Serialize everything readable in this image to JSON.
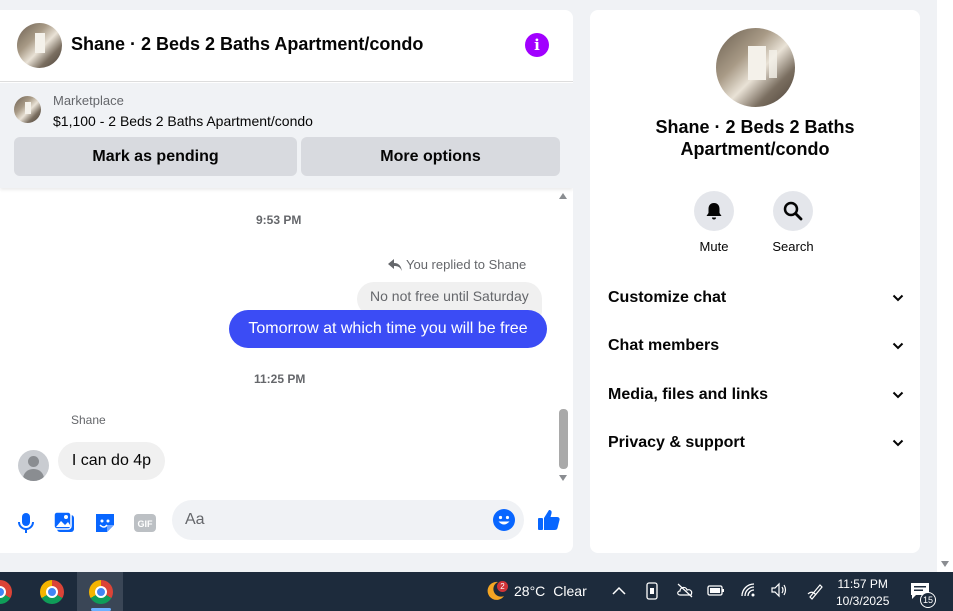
{
  "chat": {
    "title": "Shane · 2 Beds 2 Baths Apartment/condo",
    "marketplace": {
      "label": "Marketplace",
      "listing": "$1,100 - 2 Beds 2 Baths Apartment/condo",
      "pending_button": "Mark as pending",
      "more_button": "More options"
    },
    "messages": {
      "time1": "9:53 PM",
      "replied_label": "You replied to Shane",
      "quoted_text": "No not free until Saturday",
      "outgoing_text": "Tomorrow at which time you will be free",
      "time2": "11:25 PM",
      "sender_name": "Shane",
      "incoming_text": "I can do 4p"
    },
    "composer": {
      "placeholder": "Aa"
    }
  },
  "details": {
    "title": "Shane · 2 Beds 2 Baths Apartment/condo",
    "actions": [
      {
        "label": "Mute",
        "icon": "bell-icon"
      },
      {
        "label": "Search",
        "icon": "search-icon"
      }
    ],
    "sections": [
      {
        "label": "Customize chat"
      },
      {
        "label": "Chat members"
      },
      {
        "label": "Media, files and links"
      },
      {
        "label": "Privacy & support"
      }
    ]
  },
  "taskbar": {
    "weather_badge": "2",
    "temperature": "28°C",
    "condition": "Clear",
    "time": "11:57 PM",
    "date": "10/3/2025",
    "notification_count": "15"
  },
  "colors": {
    "accent": "#0866ff",
    "outgoing_bubble": "#3b4cf5",
    "info": "#a100ff",
    "taskbar": "#1d2b3c"
  }
}
